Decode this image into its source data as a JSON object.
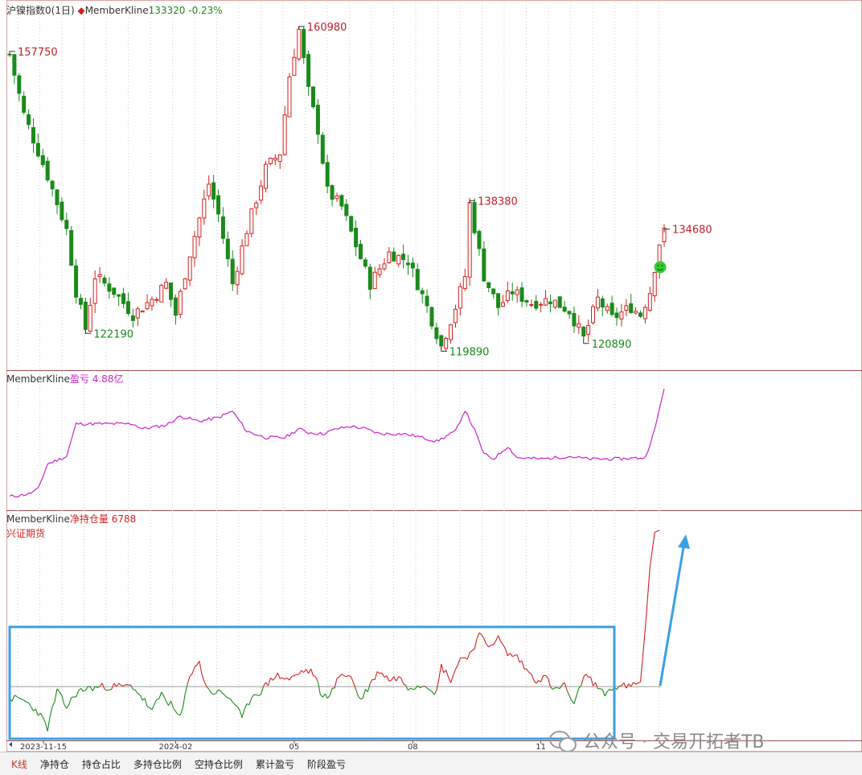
{
  "panel1": {
    "index_name": "沪镍指数0(1日)",
    "indicator_name": "MemberKline",
    "price": "133320",
    "change": "-0.23%",
    "diamond_icon": "diamond-icon"
  },
  "panel2": {
    "indicator_name": "MemberKline",
    "metric_label": "盈亏",
    "metric_value": "4.88亿"
  },
  "panel3": {
    "indicator_name": "MemberKline",
    "metric_label": "净持仓量",
    "metric_value": "6788",
    "member_name": "兴证期货"
  },
  "x_axis": {
    "ticks": [
      "2023-11-15",
      "2024-02",
      "05",
      "08",
      "11"
    ]
  },
  "watermark": "公众号 · 交易开拓者TB",
  "tabs": [
    "K线",
    "净持仓",
    "持仓占比",
    "多持仓比例",
    "空持仓比例",
    "累计盈亏",
    "阶段盈亏"
  ],
  "colors": {
    "up": "#d4201f",
    "down": "#1a8a1a",
    "pnl": "#cc22cc",
    "annotation_box": "#3aa0e6",
    "arrow": "#3aa0e6",
    "marker": "#33cc33"
  },
  "chart_data": [
    {
      "type": "candlestick",
      "title": "沪镍指数0(1日)",
      "x": [
        "2023-11-15",
        "2024-02",
        "05",
        "08",
        "11"
      ],
      "close_profile": [
        {
          "x": 0,
          "y": 157750
        },
        {
          "x": 3,
          "y": 150000
        },
        {
          "x": 8,
          "y": 142000
        },
        {
          "x": 12,
          "y": 135000
        },
        {
          "x": 14,
          "y": 127000
        },
        {
          "x": 16,
          "y": 122190
        },
        {
          "x": 18,
          "y": 129000
        },
        {
          "x": 22,
          "y": 127000
        },
        {
          "x": 26,
          "y": 124000
        },
        {
          "x": 30,
          "y": 126000
        },
        {
          "x": 33,
          "y": 128000
        },
        {
          "x": 35,
          "y": 124000
        },
        {
          "x": 38,
          "y": 132000
        },
        {
          "x": 42,
          "y": 141000
        },
        {
          "x": 44,
          "y": 137000
        },
        {
          "x": 47,
          "y": 128000
        },
        {
          "x": 50,
          "y": 135000
        },
        {
          "x": 54,
          "y": 143000
        },
        {
          "x": 57,
          "y": 145000
        },
        {
          "x": 59,
          "y": 155000
        },
        {
          "x": 61,
          "y": 160980
        },
        {
          "x": 63,
          "y": 153000
        },
        {
          "x": 65,
          "y": 148000
        },
        {
          "x": 67,
          "y": 140000
        },
        {
          "x": 70,
          "y": 138000
        },
        {
          "x": 73,
          "y": 133000
        },
        {
          "x": 76,
          "y": 128000
        },
        {
          "x": 80,
          "y": 132000
        },
        {
          "x": 84,
          "y": 131000
        },
        {
          "x": 88,
          "y": 125000
        },
        {
          "x": 91,
          "y": 119890
        },
        {
          "x": 94,
          "y": 125000
        },
        {
          "x": 96,
          "y": 129000
        },
        {
          "x": 97,
          "y": 138380
        },
        {
          "x": 100,
          "y": 129000
        },
        {
          "x": 103,
          "y": 125000
        },
        {
          "x": 106,
          "y": 127000
        },
        {
          "x": 110,
          "y": 125500
        },
        {
          "x": 114,
          "y": 126000
        },
        {
          "x": 118,
          "y": 124500
        },
        {
          "x": 121,
          "y": 120890
        },
        {
          "x": 124,
          "y": 126000
        },
        {
          "x": 127,
          "y": 123500
        },
        {
          "x": 131,
          "y": 125000
        },
        {
          "x": 133,
          "y": 124000
        },
        {
          "x": 135,
          "y": 127000
        },
        {
          "x": 137,
          "y": 133320
        },
        {
          "x": 138,
          "y": 134680
        }
      ],
      "annotations": [
        {
          "label": "157750",
          "x": 0,
          "y": 157750,
          "kind": "high"
        },
        {
          "label": "160980",
          "x": 61,
          "y": 160980,
          "kind": "high"
        },
        {
          "label": "138380",
          "x": 97,
          "y": 138380,
          "kind": "high"
        },
        {
          "label": "134680",
          "x": 138,
          "y": 134680,
          "kind": "high"
        },
        {
          "label": "122190",
          "x": 16,
          "y": 122190,
          "kind": "low"
        },
        {
          "label": "119890",
          "x": 91,
          "y": 119890,
          "kind": "low"
        },
        {
          "label": "120890",
          "x": 121,
          "y": 120890,
          "kind": "low"
        }
      ],
      "ylim": [
        117000,
        164000
      ]
    },
    {
      "type": "line",
      "title": "MemberKline盈亏 4.88亿",
      "series": [
        {
          "name": "盈亏",
          "values": [
            {
              "x": 0,
              "y": -3.8
            },
            {
              "x": 4,
              "y": -3.6
            },
            {
              "x": 6,
              "y": -3.2
            },
            {
              "x": 8,
              "y": -1.2
            },
            {
              "x": 10,
              "y": -0.9
            },
            {
              "x": 12,
              "y": -0.6
            },
            {
              "x": 14,
              "y": 2.0
            },
            {
              "x": 20,
              "y": 2.0
            },
            {
              "x": 26,
              "y": 2.0
            },
            {
              "x": 28,
              "y": 1.6
            },
            {
              "x": 33,
              "y": 1.9
            },
            {
              "x": 36,
              "y": 2.6
            },
            {
              "x": 40,
              "y": 2.2
            },
            {
              "x": 44,
              "y": 2.5
            },
            {
              "x": 47,
              "y": 3.0
            },
            {
              "x": 50,
              "y": 1.4
            },
            {
              "x": 54,
              "y": 0.9
            },
            {
              "x": 58,
              "y": 0.9
            },
            {
              "x": 61,
              "y": 1.6
            },
            {
              "x": 63,
              "y": 1.3
            },
            {
              "x": 66,
              "y": 1.2
            },
            {
              "x": 69,
              "y": 1.6
            },
            {
              "x": 72,
              "y": 1.8
            },
            {
              "x": 75,
              "y": 1.6
            },
            {
              "x": 78,
              "y": 1.2
            },
            {
              "x": 83,
              "y": 1.2
            },
            {
              "x": 86,
              "y": 1.0
            },
            {
              "x": 90,
              "y": 0.6
            },
            {
              "x": 94,
              "y": 1.4
            },
            {
              "x": 96,
              "y": 3.1
            },
            {
              "x": 98,
              "y": 1.5
            },
            {
              "x": 100,
              "y": -0.4
            },
            {
              "x": 102,
              "y": -0.8
            },
            {
              "x": 105,
              "y": 0.2
            },
            {
              "x": 107,
              "y": -0.7
            },
            {
              "x": 112,
              "y": -0.8
            },
            {
              "x": 118,
              "y": -0.6
            },
            {
              "x": 122,
              "y": -0.8
            },
            {
              "x": 128,
              "y": -0.8
            },
            {
              "x": 134,
              "y": -0.7
            },
            {
              "x": 136,
              "y": 1.5
            },
            {
              "x": 138,
              "y": 4.88
            }
          ]
        }
      ],
      "ylim": [
        -4.5,
        5.5
      ]
    },
    {
      "type": "area",
      "title": "MemberKline净持仓量 6788",
      "subtitle": "兴证期货",
      "series": [
        {
          "name": "兴证期货",
          "values": [
            {
              "x": 0,
              "y": -500
            },
            {
              "x": 3,
              "y": -600
            },
            {
              "x": 6,
              "y": -1100
            },
            {
              "x": 8,
              "y": -1800
            },
            {
              "x": 10,
              "y": -200
            },
            {
              "x": 12,
              "y": -900
            },
            {
              "x": 14,
              "y": -300
            },
            {
              "x": 16,
              "y": -100
            },
            {
              "x": 20,
              "y": 0
            },
            {
              "x": 26,
              "y": 0
            },
            {
              "x": 28,
              "y": -500
            },
            {
              "x": 30,
              "y": -1100
            },
            {
              "x": 32,
              "y": -300
            },
            {
              "x": 34,
              "y": -800
            },
            {
              "x": 36,
              "y": -1400
            },
            {
              "x": 38,
              "y": 500
            },
            {
              "x": 39,
              "y": 900
            },
            {
              "x": 40,
              "y": 1000
            },
            {
              "x": 41,
              "y": 300
            },
            {
              "x": 42,
              "y": -200
            },
            {
              "x": 45,
              "y": -300
            },
            {
              "x": 47,
              "y": -600
            },
            {
              "x": 49,
              "y": -1400
            },
            {
              "x": 51,
              "y": -400
            },
            {
              "x": 53,
              "y": -200
            },
            {
              "x": 56,
              "y": 500
            },
            {
              "x": 59,
              "y": 300
            },
            {
              "x": 62,
              "y": 700
            },
            {
              "x": 64,
              "y": 600
            },
            {
              "x": 66,
              "y": -500
            },
            {
              "x": 68,
              "y": -200
            },
            {
              "x": 70,
              "y": 600
            },
            {
              "x": 72,
              "y": 400
            },
            {
              "x": 74,
              "y": -600
            },
            {
              "x": 76,
              "y": 100
            },
            {
              "x": 78,
              "y": 700
            },
            {
              "x": 80,
              "y": 300
            },
            {
              "x": 82,
              "y": 400
            },
            {
              "x": 84,
              "y": 0
            },
            {
              "x": 88,
              "y": 100
            },
            {
              "x": 90,
              "y": -300
            },
            {
              "x": 91,
              "y": 900
            },
            {
              "x": 93,
              "y": 300
            },
            {
              "x": 95,
              "y": 1200
            },
            {
              "x": 97,
              "y": 1400
            },
            {
              "x": 99,
              "y": 2200
            },
            {
              "x": 101,
              "y": 1800
            },
            {
              "x": 103,
              "y": 2100
            },
            {
              "x": 105,
              "y": 1400
            },
            {
              "x": 107,
              "y": 1300
            },
            {
              "x": 109,
              "y": 700
            },
            {
              "x": 111,
              "y": 300
            },
            {
              "x": 113,
              "y": 400
            },
            {
              "x": 115,
              "y": -200
            },
            {
              "x": 117,
              "y": 100
            },
            {
              "x": 119,
              "y": -900
            },
            {
              "x": 121,
              "y": 500
            },
            {
              "x": 123,
              "y": 200
            },
            {
              "x": 125,
              "y": -300
            },
            {
              "x": 128,
              "y": 0
            },
            {
              "x": 131,
              "y": 0
            },
            {
              "x": 133,
              "y": 200
            },
            {
              "x": 134,
              "y": 2500
            },
            {
              "x": 135,
              "y": 5200
            },
            {
              "x": 136,
              "y": 6700
            },
            {
              "x": 137,
              "y": 6788
            }
          ]
        }
      ],
      "ylim": [
        -2200,
        7100
      ]
    }
  ]
}
